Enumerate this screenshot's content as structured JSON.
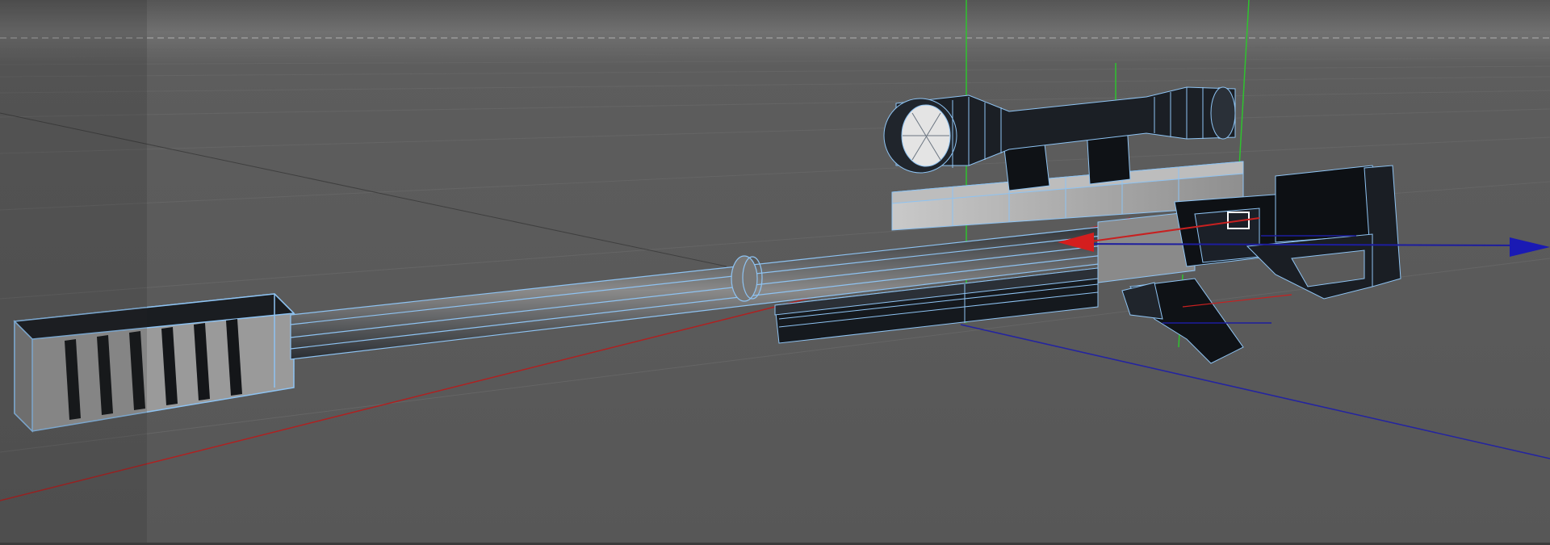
{
  "viewport": {
    "background": "#5a5a5a",
    "horizon_color": "#6e6e6e",
    "grid_color": "#626262",
    "wire_color": "#8ec3f2",
    "dark_face": "#111418",
    "light_face": "#a6a6a6",
    "axis_x_color": "#cc2222",
    "axis_y_color": "#33cc33",
    "axis_z_color": "#1a1aaa"
  },
  "scene": {
    "object": "rifle-model",
    "selected_tool": "move-gizmo",
    "icons": [
      "move-gizmo-x-arrow-icon",
      "move-gizmo-z-arrow-icon",
      "object-center-icon"
    ]
  }
}
